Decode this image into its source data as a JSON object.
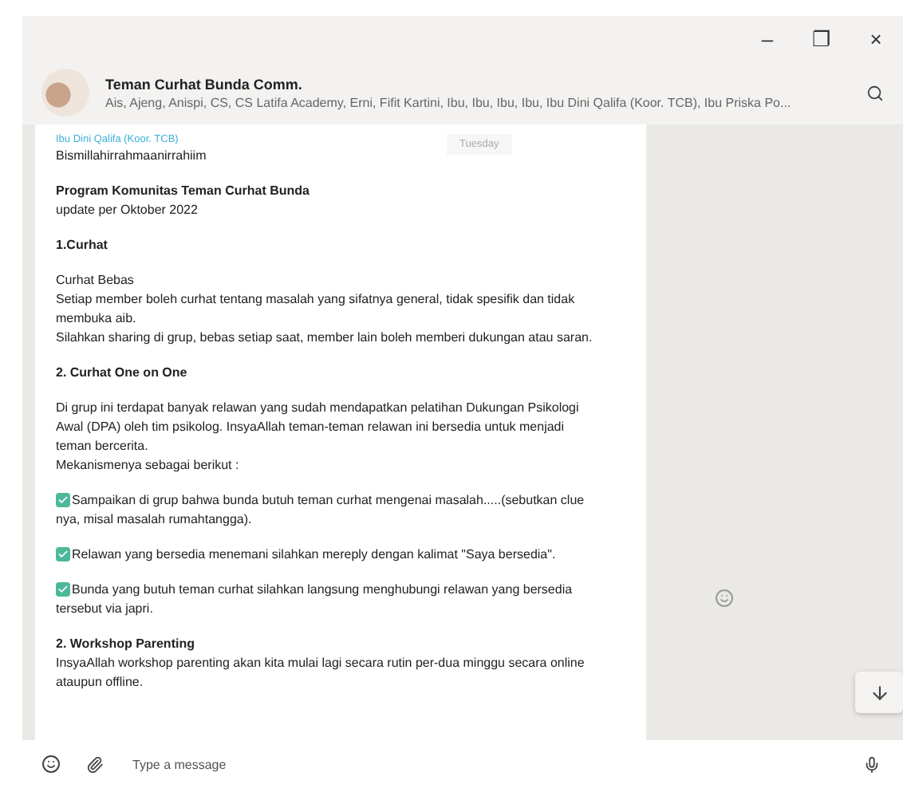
{
  "window": {
    "controls": [
      "–",
      "❐",
      "×"
    ]
  },
  "chat": {
    "title": "Teman Curhat Bunda Comm.",
    "members": "Ais, Ajeng, Anispi, CS, CS Latifa Academy, Erni, Fifit Kartini, Ibu, Ibu, Ibu, Ibu, Ibu Dini Qalifa (Koor. TCB), Ibu Priska Po..."
  },
  "date_badge": "Tuesday",
  "message": {
    "sender": "Ibu Dini Qalifa (Koor. TCB)",
    "blocks": [
      {
        "kind": "text",
        "text": "Bismillahirrahmaanirrahiim"
      },
      {
        "kind": "heading",
        "text": "Program Komunitas Teman Curhat Bunda",
        "sub": "update per Oktober 2022"
      },
      {
        "kind": "heading",
        "text": "1.Curhat"
      },
      {
        "kind": "text",
        "text": "Curhat Bebas\nSetiap member boleh curhat tentang masalah yang sifatnya general, tidak spesifik dan tidak membuka aib.\nSilahkan sharing di grup, bebas setiap saat, member lain boleh memberi dukungan atau saran."
      },
      {
        "kind": "heading",
        "text": "2. Curhat One on One"
      },
      {
        "kind": "text",
        "text": "Di grup ini terdapat banyak relawan yang sudah mendapatkan pelatihan Dukungan Psikologi Awal (DPA) oleh tim psikolog. InsyaAllah teman-teman relawan ini bersedia untuk menjadi teman bercerita.\nMekanismenya sebagai berikut :"
      },
      {
        "kind": "check",
        "text": "Sampaikan di grup bahwa bunda butuh teman curhat mengenai masalah.....(sebutkan clue nya, misal masalah rumahtangga)."
      },
      {
        "kind": "check",
        "text": "Relawan yang bersedia menemani silahkan mereply dengan kalimat \"Saya bersedia\"."
      },
      {
        "kind": "check",
        "text": "Bunda yang butuh teman curhat silahkan langsung menghubungi relawan yang bersedia tersebut via japri."
      },
      {
        "kind": "heading",
        "text": "2. Workshop Parenting",
        "sub": "InsyaAllah workshop parenting akan kita mulai lagi secara rutin per-dua minggu secara online ataupun offline."
      }
    ]
  },
  "composer": {
    "placeholder": "Type a message"
  }
}
